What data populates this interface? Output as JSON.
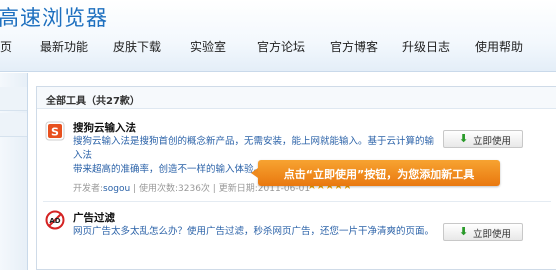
{
  "header": {
    "brand": "高速浏览器",
    "nav": [
      {
        "label": "页"
      },
      {
        "label": "最新功能"
      },
      {
        "label": "皮肤下载"
      },
      {
        "label": "实验室"
      },
      {
        "label": "官方论坛"
      },
      {
        "label": "官方博客"
      },
      {
        "label": "升级日志"
      },
      {
        "label": "使用帮助"
      }
    ]
  },
  "panel": {
    "title": "全部工具（共27款）"
  },
  "tools": [
    {
      "name": "搜狗云输入法",
      "desc_line1": "搜狗云输入法是搜狗首创的概念新产品，无需安装，能上网就能输入。基于云计算的输入法",
      "desc_line2": "带来超高的准确率，创造不一样的输入体验。",
      "meta_dev_label": "开发者:",
      "meta_dev": "sogou",
      "meta_sep": "|",
      "meta_uses_label": "使用次数:",
      "meta_uses": "3236次",
      "meta_date_label": "更新日期:",
      "meta_date": "2011-06-01",
      "stars": "★★★★★",
      "button": "立即使用",
      "icon": "sogou-input-icon",
      "accent": "#e8511f"
    },
    {
      "name": "广告过滤",
      "desc_line1": "网页广告太多太乱怎么办？使用广告过滤，秒杀网页广告，还您一片干净清爽的页面。",
      "button": "立即使用",
      "icon": "ad-block-icon",
      "accent": "#d42323"
    }
  ],
  "callout": {
    "text": "点击“立即使用”按钮，为您添加新工具",
    "color": "#f08a1c"
  }
}
